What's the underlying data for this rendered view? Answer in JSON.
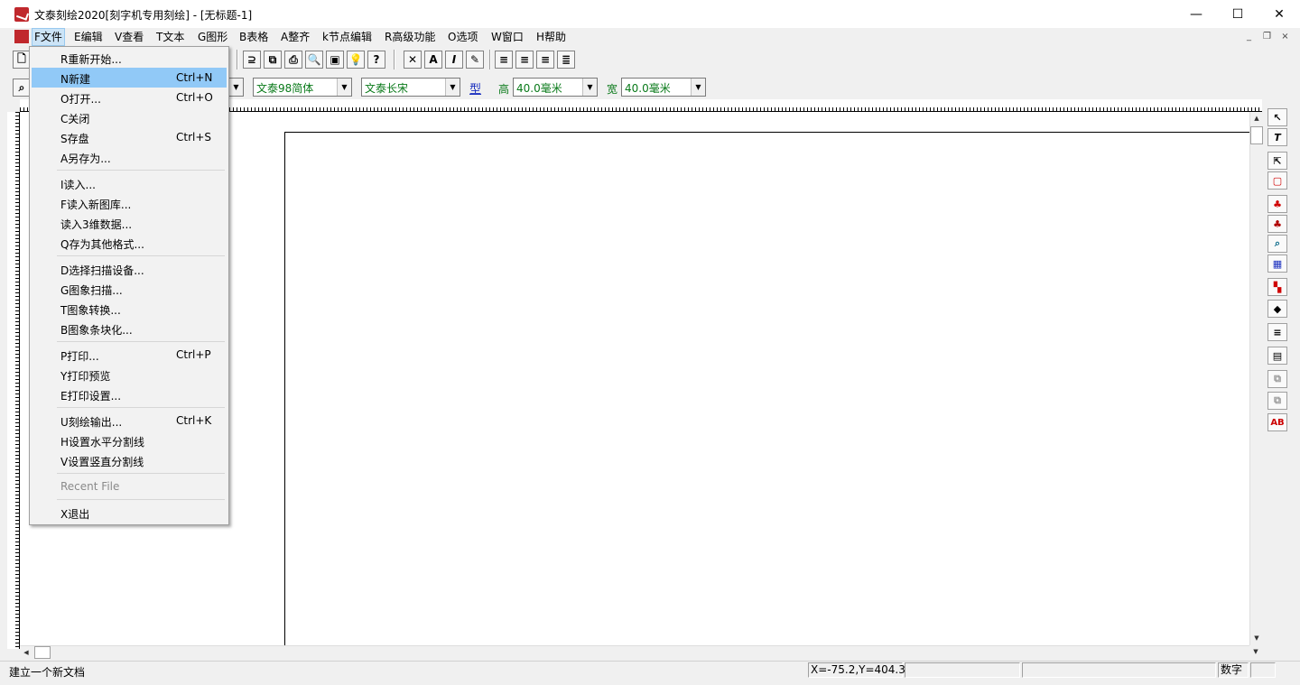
{
  "window": {
    "title": "文泰刻绘2020[刻字机专用刻绘] - [无标题-1]",
    "minimize": "—",
    "maximize": "☐",
    "close": "✕"
  },
  "menubar": {
    "items": [
      {
        "label": "F文件"
      },
      {
        "label": "E编辑"
      },
      {
        "label": "V查看"
      },
      {
        "label": "T文本"
      },
      {
        "label": "G图形"
      },
      {
        "label": "B表格"
      },
      {
        "label": "A整齐"
      },
      {
        "label": "k节点编辑"
      },
      {
        "label": "R高级功能"
      },
      {
        "label": "O选项"
      },
      {
        "label": "W窗口"
      },
      {
        "label": "H帮助"
      }
    ],
    "mdi_min": "_",
    "mdi_restore": "❐",
    "mdi_close": "×"
  },
  "file_menu": {
    "items": [
      {
        "label": "R重新开始...",
        "shortcut": ""
      },
      {
        "label": "N新建",
        "shortcut": "Ctrl+N"
      },
      {
        "label": "O打开...",
        "shortcut": "Ctrl+O"
      },
      {
        "label": "C关闭",
        "shortcut": ""
      },
      {
        "label": "S存盘",
        "shortcut": "Ctrl+S"
      },
      {
        "label": "A另存为...",
        "shortcut": ""
      },
      {
        "label": "I读入...",
        "shortcut": ""
      },
      {
        "label": "F读入新图库...",
        "shortcut": ""
      },
      {
        "label": "读入3维数据...",
        "shortcut": ""
      },
      {
        "label": "Q存为其他格式...",
        "shortcut": ""
      },
      {
        "label": "D选择扫描设备...",
        "shortcut": ""
      },
      {
        "label": "G图象扫描...",
        "shortcut": ""
      },
      {
        "label": "T图象转换...",
        "shortcut": ""
      },
      {
        "label": "B图象条块化...",
        "shortcut": ""
      },
      {
        "label": "P打印...",
        "shortcut": "Ctrl+P"
      },
      {
        "label": "Y打印预览",
        "shortcut": ""
      },
      {
        "label": "E打印设置...",
        "shortcut": ""
      },
      {
        "label": "U刻绘输出...",
        "shortcut": "Ctrl+K"
      },
      {
        "label": "H设置水平分割线",
        "shortcut": ""
      },
      {
        "label": "V设置竖直分割线",
        "shortcut": ""
      },
      {
        "label": "Recent File",
        "shortcut": ""
      },
      {
        "label": "X退出",
        "shortcut": ""
      }
    ],
    "highlighted": "N新建"
  },
  "font_toolbar": {
    "font_cn": "文泰98简体",
    "font_en": "文泰长宋",
    "type_btn": "型",
    "height_label": "高",
    "height_value": "40.0毫米",
    "width_label": "宽",
    "width_value": "40.0毫米"
  },
  "status": {
    "message": "建立一个新文档",
    "coords": "X=-75.2,Y=404.3",
    "numlock": "数字"
  },
  "colors": {
    "highlight": "#91c9f7",
    "field_text": "#0a7a1a",
    "brand_red": "#c0282d"
  }
}
